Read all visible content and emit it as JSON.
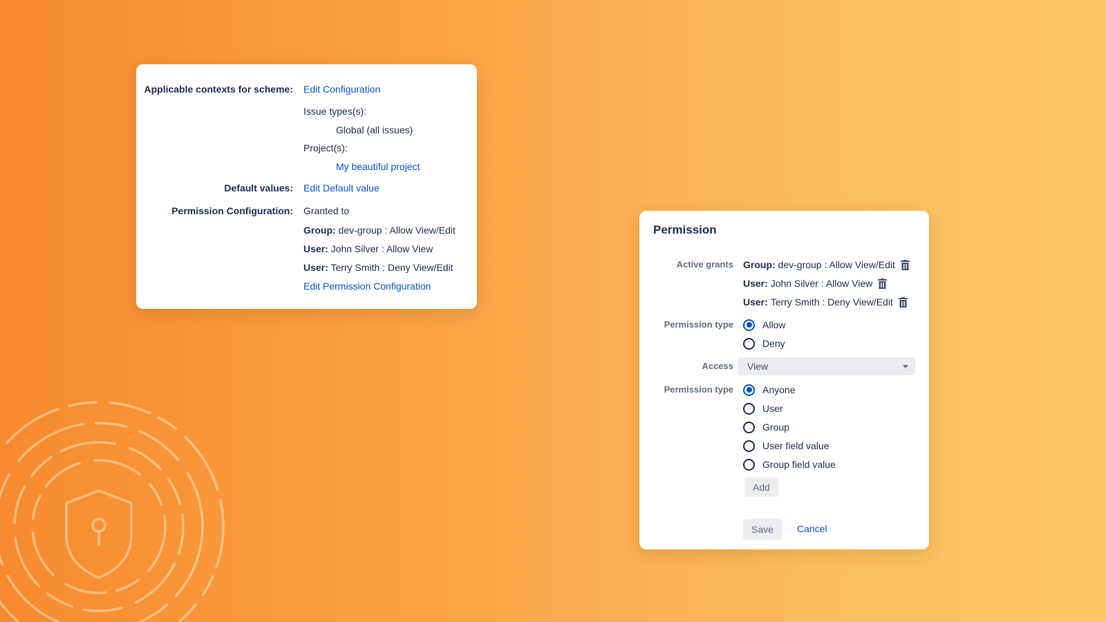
{
  "scheme": {
    "contexts_label": "Applicable contexts for scheme:",
    "edit_config_link": "Edit Configuration",
    "issue_types_label": "Issue types(s):",
    "issue_types_value": "Global (all issues)",
    "projects_label": "Project(s):",
    "project_link": "My beautiful project",
    "default_values_label": "Default values:",
    "edit_default_link": "Edit Default value",
    "perm_config_label": "Permission Configuration:",
    "granted_to": "Granted to",
    "grants": [
      {
        "kind": "Group:",
        "text": "dev-group : Allow View/Edit"
      },
      {
        "kind": "User:",
        "text": "John Silver : Allow View"
      },
      {
        "kind": "User:",
        "text": "Terry Smith : Deny View/Edit"
      }
    ],
    "edit_perm_link": "Edit Permission Configuration"
  },
  "permission": {
    "title": "Permission",
    "active_grants_label": "Active grants",
    "grants": [
      {
        "kind": "Group:",
        "text": "dev-group : Allow View/Edit"
      },
      {
        "kind": "User:",
        "text": "John Silver : Allow View"
      },
      {
        "kind": "User:",
        "text": "Terry Smith : Deny View/Edit"
      }
    ],
    "permission_type_label": "Permission type",
    "allow_label": "Allow",
    "deny_label": "Deny",
    "access_label": "Access",
    "access_value": "View",
    "permission_type_label_2": "Permission type",
    "anyone_label": "Anyone",
    "user_label": "User",
    "group_label": "Group",
    "user_field_label": "User field value",
    "group_field_label": "Group field value",
    "add_button": "Add",
    "save_button": "Save",
    "cancel_link": "Cancel"
  },
  "colors": {
    "link": "#0052cc",
    "radio_checked": "#0052cc",
    "background_start": "#f78a2e",
    "background_end": "#fec868"
  }
}
